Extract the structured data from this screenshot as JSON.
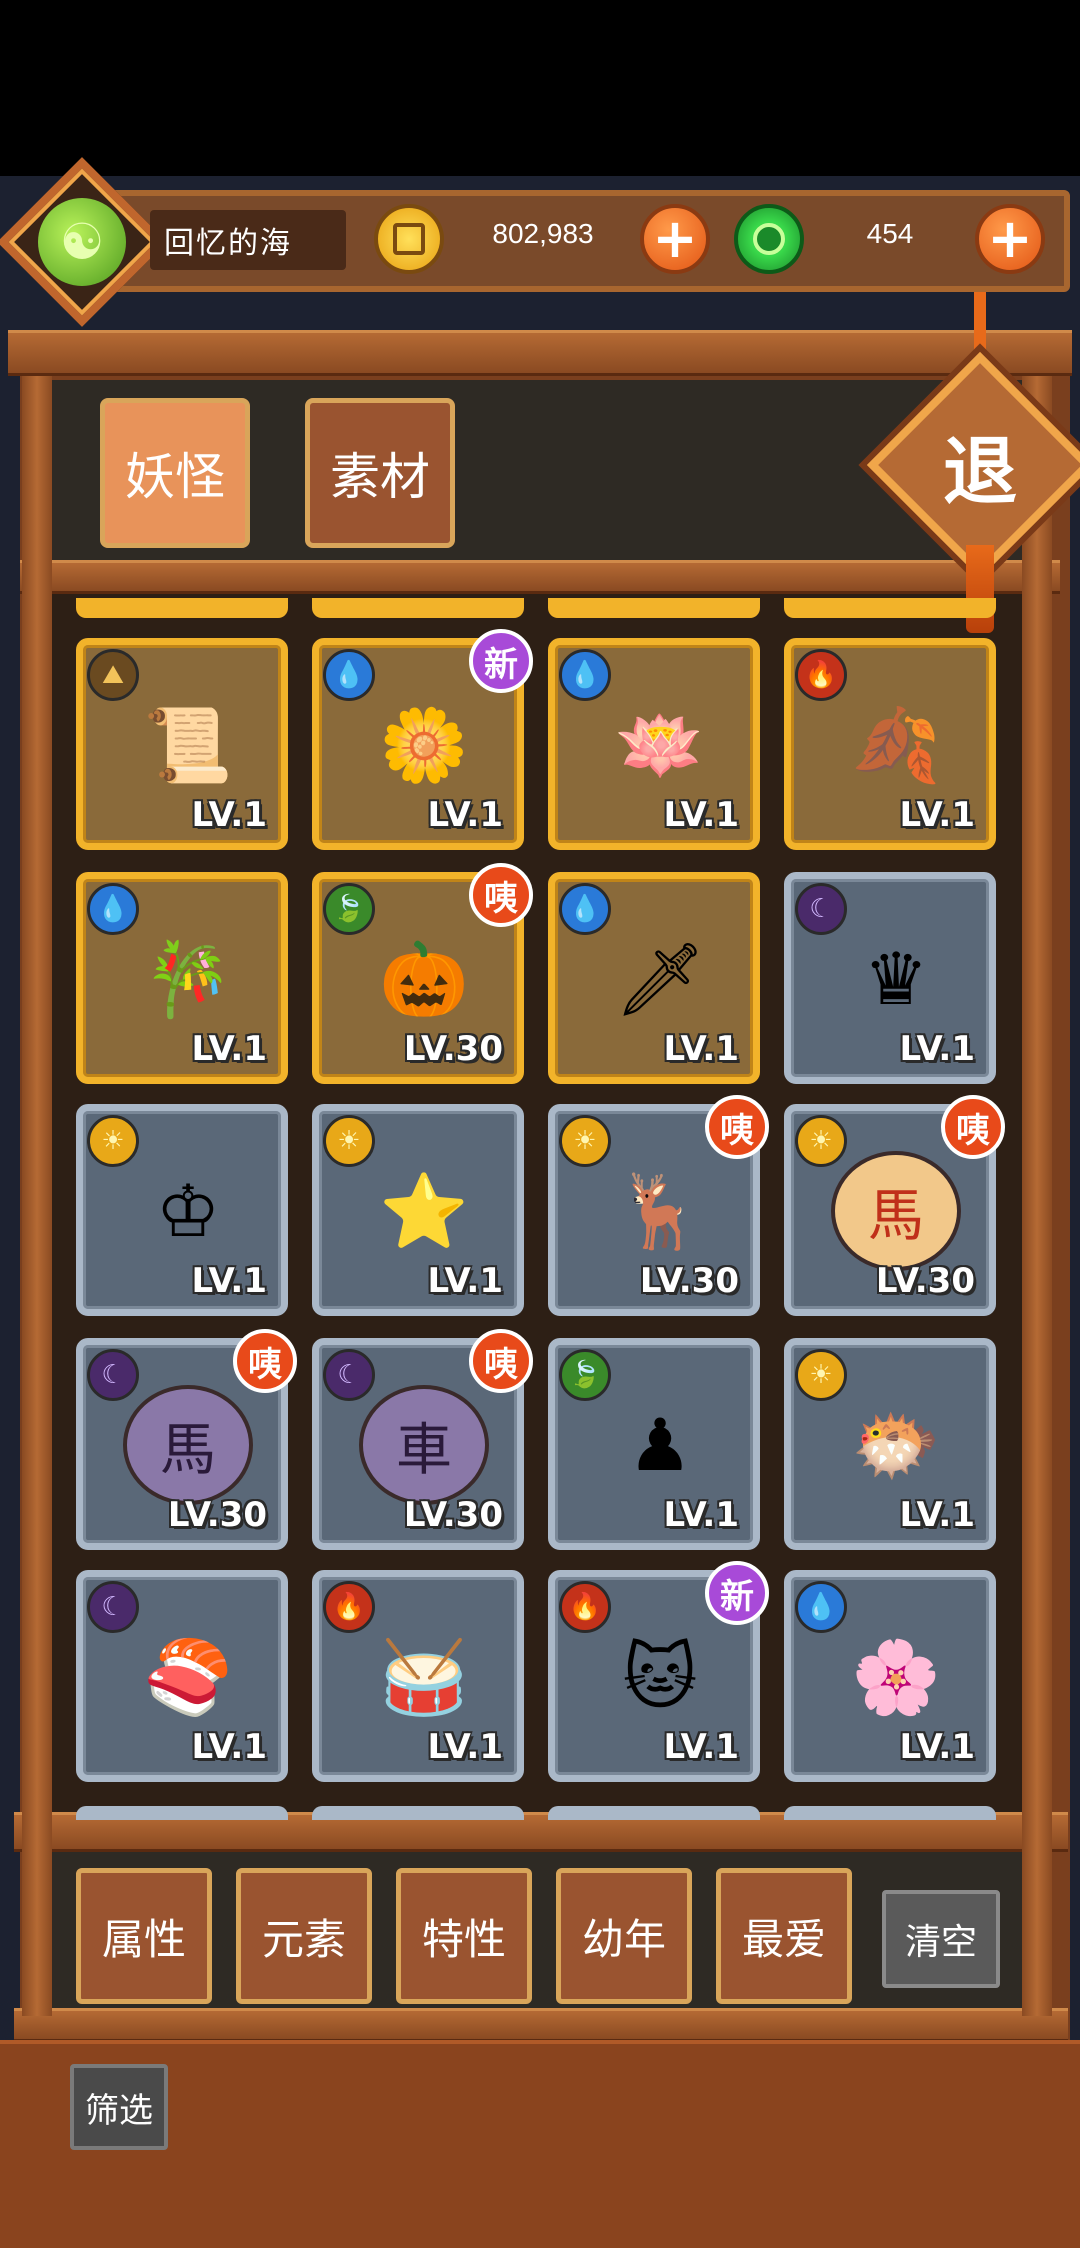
{
  "header": {
    "player_name": "回忆的海",
    "coins": "802,983",
    "gems": "454",
    "coin_icon": "copper-coin-icon",
    "gem_icon": "jade-gem-icon",
    "plus_label": "+"
  },
  "tabs": [
    {
      "label": "妖怪",
      "active": true
    },
    {
      "label": "素材",
      "active": false
    }
  ],
  "exit_label": "退",
  "cards": [
    {
      "element": "earth",
      "art": "scroll-spirit",
      "level": "LV.1",
      "frame": "gold",
      "badge": ""
    },
    {
      "element": "water",
      "art": "white-flower-spirit",
      "level": "LV.1",
      "frame": "gold",
      "badge": "新"
    },
    {
      "element": "water",
      "art": "lotus-spirit",
      "level": "LV.1",
      "frame": "gold",
      "badge": ""
    },
    {
      "element": "fire",
      "art": "autumn-leaf-bird",
      "level": "LV.1",
      "frame": "gold",
      "badge": ""
    },
    {
      "element": "water",
      "art": "bamboo-flute-spirit",
      "level": "LV.1",
      "frame": "gold",
      "badge": ""
    },
    {
      "element": "wood",
      "art": "gourd-ghost",
      "level": "LV.30",
      "frame": "gold",
      "badge": "咦"
    },
    {
      "element": "water",
      "art": "sword-spirit",
      "level": "LV.1",
      "frame": "gold",
      "badge": ""
    },
    {
      "element": "dark",
      "art": "black-chess-queen",
      "level": "LV.1",
      "frame": "silver",
      "badge": ""
    },
    {
      "element": "light",
      "art": "white-chess-king",
      "level": "LV.1",
      "frame": "silver",
      "badge": ""
    },
    {
      "element": "light",
      "art": "gold-star-libra",
      "level": "LV.1",
      "frame": "silver",
      "badge": ""
    },
    {
      "element": "light",
      "art": "deer-spirit",
      "level": "LV.30",
      "frame": "silver",
      "badge": "咦"
    },
    {
      "element": "light",
      "art": "xiangqi-horse-red",
      "level": "LV.30",
      "frame": "silver",
      "badge": "咦"
    },
    {
      "element": "dark",
      "art": "xiangqi-horse-purple",
      "level": "LV.30",
      "frame": "silver",
      "badge": "咦"
    },
    {
      "element": "dark",
      "art": "xiangqi-chariot-purple",
      "level": "LV.30",
      "frame": "silver",
      "badge": "咦"
    },
    {
      "element": "wood",
      "art": "wooden-pawn",
      "level": "LV.1",
      "frame": "silver",
      "badge": ""
    },
    {
      "element": "light",
      "art": "pufferfish",
      "level": "LV.1",
      "frame": "silver",
      "badge": ""
    },
    {
      "element": "dark",
      "art": "sushi-roll",
      "level": "LV.1",
      "frame": "silver",
      "badge": ""
    },
    {
      "element": "fire",
      "art": "red-drum",
      "level": "LV.1",
      "frame": "silver",
      "badge": ""
    },
    {
      "element": "fire",
      "art": "propeller-cat",
      "level": "LV.1",
      "frame": "silver",
      "badge": "新"
    },
    {
      "element": "water",
      "art": "white-peony-spirit",
      "level": "LV.1",
      "frame": "silver",
      "badge": ""
    }
  ],
  "filters": [
    "属性",
    "元素",
    "特性",
    "幼年",
    "最爱"
  ],
  "clear_label": "清空",
  "screen_label": "筛选",
  "colors": {
    "gold_frame": "#f2b32a",
    "silver_frame": "#aab8c8",
    "wood": "#7a3f1e",
    "badge_new": "#a84ad8",
    "badge_hey": "#e84a1a"
  }
}
